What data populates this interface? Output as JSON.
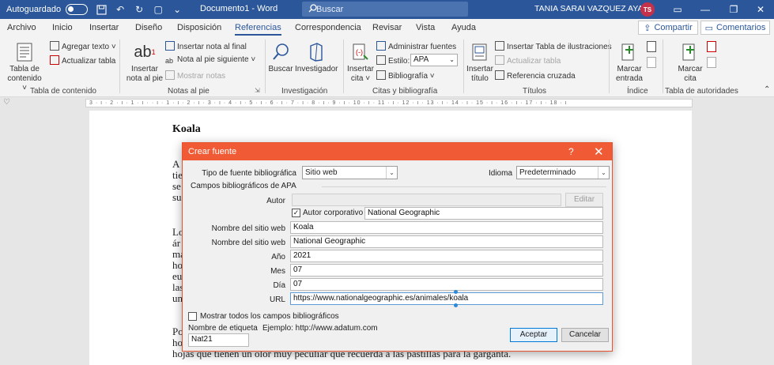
{
  "titlebar": {
    "autosave_label": "Autoguardado",
    "doc_title": "Documento1  -  Word",
    "search_placeholder": "Buscar",
    "user_name": "TANIA SARAI VAZQUEZ AYALA",
    "user_initials": "TS"
  },
  "menu": {
    "tabs": [
      "Archivo",
      "Inicio",
      "Insertar",
      "Diseño",
      "Disposición",
      "Referencias",
      "Correspondencia",
      "Revisar",
      "Vista",
      "Ayuda"
    ],
    "active_tab": "Referencias",
    "share_label": "Compartir",
    "comments_label": "Comentarios"
  },
  "ribbon": {
    "toc": {
      "big_label_1": "Tabla de",
      "big_label_2": "contenido ˅",
      "add_text": "Agregar texto ˅",
      "update_table": "Actualizar tabla",
      "group": "Tabla de contenido"
    },
    "footnotes": {
      "big_label_1": "Insertar",
      "big_label_2": "nota al pie",
      "insert_endnote": "Insertar nota al final",
      "next_footnote": "Nota al pie siguiente  ˅",
      "show_notes": "Mostrar notas",
      "group": "Notas al pie"
    },
    "research": {
      "search": "Buscar",
      "researcher": "Investigador",
      "group": "Investigación"
    },
    "citations": {
      "big_label_1": "Insertar",
      "big_label_2": "cita ˅",
      "manage_sources": "Administrar fuentes",
      "style_label": "Estilo:",
      "style_value": "APA",
      "bibliography": "Bibliografía ˅",
      "group": "Citas y bibliografía"
    },
    "captions": {
      "big_label_1": "Insertar",
      "big_label_2": "título",
      "insert_table_figures": "Insertar Tabla de ilustraciones",
      "update_table": "Actualizar tabla",
      "cross_reference": "Referencia cruzada",
      "group": "Títulos"
    },
    "index": {
      "big_label_1": "Marcar",
      "big_label_2": "entrada",
      "group": "Índice"
    },
    "authorities": {
      "big_label_1": "Marcar",
      "big_label_2": "cita",
      "group": "Tabla de autoridades"
    }
  },
  "ruler_text": "3 · ı · 2 · ı · 1 · ı ·  · ı · 1 · ı · 2 · ı · 3 · ı · 4 · ı · 5 · ı · 6 · ı · 7 · ı · 8 · ı · 9 · ı · 10 · ı · 11 · ı · 12 · ı · 13 · ı · 14 · ı · 15 · ı · 16 · ı · 17 · ı · 18 · ı",
  "document": {
    "heading": "Koala",
    "line_fragments": [
      "A",
      "tie",
      "se",
      "su",
      "Lo",
      "ár",
      "ma",
      "ho",
      "eu",
      "las",
      "un",
      "Po",
      "ho"
    ],
    "last_line": "hojas que tienen un olor muy peculiar que recuerda a las pastillas para la garganta."
  },
  "dialog": {
    "title": "Crear fuente",
    "help": "?",
    "source_type_label": "Tipo de fuente bibliográfica",
    "source_type_value": "Sitio web",
    "language_label": "Idioma",
    "language_value": "Predeterminado",
    "section_title": "Campos bibliográficos de APA",
    "author_label": "Autor",
    "author_value": "",
    "edit_button": "Editar",
    "corporate_author_label": "Autor corporativo",
    "corporate_author_checked": true,
    "corporate_author_value": "National Geographic",
    "page_name_label": "Nombre del sitio web",
    "page_name_value": "Koala",
    "site_name_label": "Nombre del sitio web",
    "site_name_value": "National Geographic",
    "year_label": "Año",
    "year_value": "2021",
    "month_label": "Mes",
    "month_value": "07",
    "day_label": "Día",
    "day_value": "07",
    "url_label": "URL",
    "url_value": "https://www.nationalgeographic.es/animales/koala",
    "show_all_label": "Mostrar todos los campos bibliográficos",
    "show_all_checked": false,
    "tag_name_label": "Nombre de etiqueta",
    "example_text": "Ejemplo: http://www.adatum.com",
    "tag_name_value": "Nat21",
    "ok_button": "Aceptar",
    "cancel_button": "Cancelar"
  },
  "colors": {
    "word_blue": "#2b579a",
    "dialog_title": "#f05a34"
  }
}
